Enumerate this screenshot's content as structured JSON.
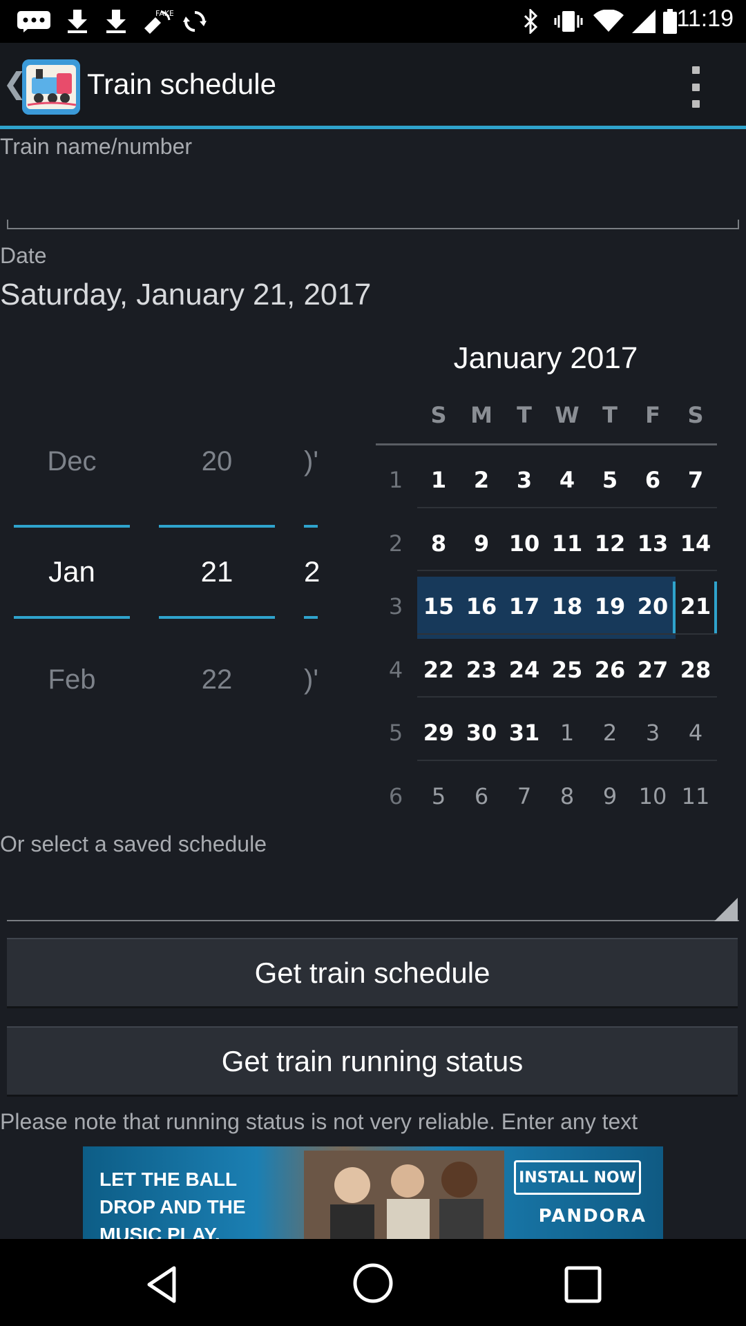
{
  "status_bar": {
    "time": "11:19",
    "icons": [
      "messaging-icon",
      "download-icon",
      "download-icon",
      "fake-gps-icon",
      "sync-icon",
      "bluetooth-icon",
      "vibrate-icon",
      "wifi-icon",
      "signal-icon",
      "battery-icon"
    ]
  },
  "action_bar": {
    "title": "Train schedule",
    "icon": "train-icon",
    "accent_color": "#2fa3cc"
  },
  "train_field": {
    "label": "Train name/number",
    "value": ""
  },
  "date": {
    "label": "Date",
    "value": "Saturday, January 21, 2017"
  },
  "spinner": {
    "month": {
      "prev": "Dec",
      "current": "Jan",
      "next": "Feb"
    },
    "day": {
      "prev": "20",
      "current": "21",
      "next": "22"
    },
    "year": {
      "prev": ")'",
      "current": "2",
      "next": ")'"
    }
  },
  "calendar": {
    "month_title": "January 2017",
    "weekdays": [
      "S",
      "M",
      "T",
      "W",
      "T",
      "F",
      "S"
    ],
    "weeks": [
      {
        "num": "1",
        "days": [
          "1",
          "2",
          "3",
          "4",
          "5",
          "6",
          "7"
        ]
      },
      {
        "num": "2",
        "days": [
          "8",
          "9",
          "10",
          "11",
          "12",
          "13",
          "14"
        ]
      },
      {
        "num": "3",
        "days": [
          "15",
          "16",
          "17",
          "18",
          "19",
          "20",
          "21"
        ]
      },
      {
        "num": "4",
        "days": [
          "22",
          "23",
          "24",
          "25",
          "26",
          "27",
          "28"
        ]
      },
      {
        "num": "5",
        "days": [
          "29",
          "30",
          "31",
          "1",
          "2",
          "3",
          "4"
        ]
      },
      {
        "num": "6",
        "days": [
          "5",
          "6",
          "7",
          "8",
          "9",
          "10",
          "11"
        ]
      }
    ],
    "selected_day": "21",
    "selected_week_color": "#17395a"
  },
  "saved_schedule": {
    "label": "Or select a saved schedule",
    "value": ""
  },
  "buttons": {
    "get_schedule": "Get train schedule",
    "get_status": "Get train running status"
  },
  "note": "Please note that running status is not very reliable. Enter any text",
  "ad": {
    "headline": "LET THE BALL DROP AND THE MUSIC PLAY.",
    "cta": "INSTALL NOW",
    "brand": "PANDORA"
  },
  "nav_bar": {
    "back": "back-icon",
    "home": "home-icon",
    "recents": "recents-icon"
  }
}
